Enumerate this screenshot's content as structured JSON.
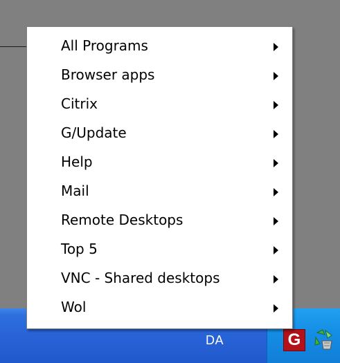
{
  "colors": {
    "desktop_background": "#808080",
    "menu_background": "#ffffff",
    "taskbar_blue": "#2762d6",
    "systray_blue": "#168fe6",
    "g_icon_red": "#b3121a"
  },
  "taskbar": {
    "label": "DA"
  },
  "systray": {
    "icons": [
      {
        "name": "g-app-icon",
        "text": "G"
      },
      {
        "name": "recycle-icon"
      }
    ]
  },
  "menu": {
    "items": [
      {
        "label": "All Programs",
        "has_submenu": true
      },
      {
        "label": "Browser apps",
        "has_submenu": true
      },
      {
        "label": "Citrix",
        "has_submenu": true
      },
      {
        "label": "G/Update",
        "has_submenu": true
      },
      {
        "label": "Help",
        "has_submenu": true
      },
      {
        "label": "Mail",
        "has_submenu": true
      },
      {
        "label": "Remote Desktops",
        "has_submenu": true
      },
      {
        "label": "Top 5",
        "has_submenu": true
      },
      {
        "label": "VNC - Shared desktops",
        "has_submenu": true
      },
      {
        "label": "Wol",
        "has_submenu": true
      }
    ]
  }
}
